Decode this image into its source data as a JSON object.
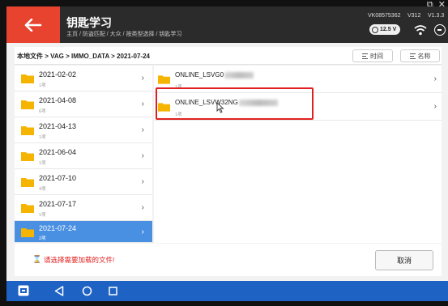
{
  "window_controls": {
    "restore": "⧉",
    "close": "✕"
  },
  "header": {
    "title": "钥匙学习",
    "breadcrumb": "主页 / 防盗匹配 / 大众 / 按类型选择 / 钥匙学习",
    "vin": "VK08575362",
    "version_a": "V312",
    "version_b": "V1.3.3",
    "battery_voltage": "12.5 V"
  },
  "path": {
    "text": "本地文件 > VAG > IMMO_DATA > 2021-07-24",
    "sort_time_label": "时间",
    "sort_name_label": "名称"
  },
  "folders": [
    {
      "name": "2021-02-02",
      "count": "1项"
    },
    {
      "name": "2021-04-08",
      "count": "6项"
    },
    {
      "name": "2021-04-13",
      "count": "1项"
    },
    {
      "name": "2021-06-04",
      "count": "1项"
    },
    {
      "name": "2021-07-10",
      "count": "4项"
    },
    {
      "name": "2021-07-17",
      "count": "1项"
    },
    {
      "name": "2021-07-24",
      "count": "2项",
      "selected": true
    }
  ],
  "files": [
    {
      "name": "ONLINE_LSVG0",
      "count": "1项"
    },
    {
      "name": "ONLINE_LSVW32NG",
      "count": "1项"
    }
  ],
  "footer": {
    "warning_icon": "⌛",
    "warning_text": "请选择需要加载的文件!",
    "cancel_label": "取消"
  },
  "colors": {
    "accent_red": "#e7432f",
    "selection_blue": "#4a90e2",
    "folder_yellow": "#f5b400",
    "navbar_blue": "#1e62c4"
  }
}
